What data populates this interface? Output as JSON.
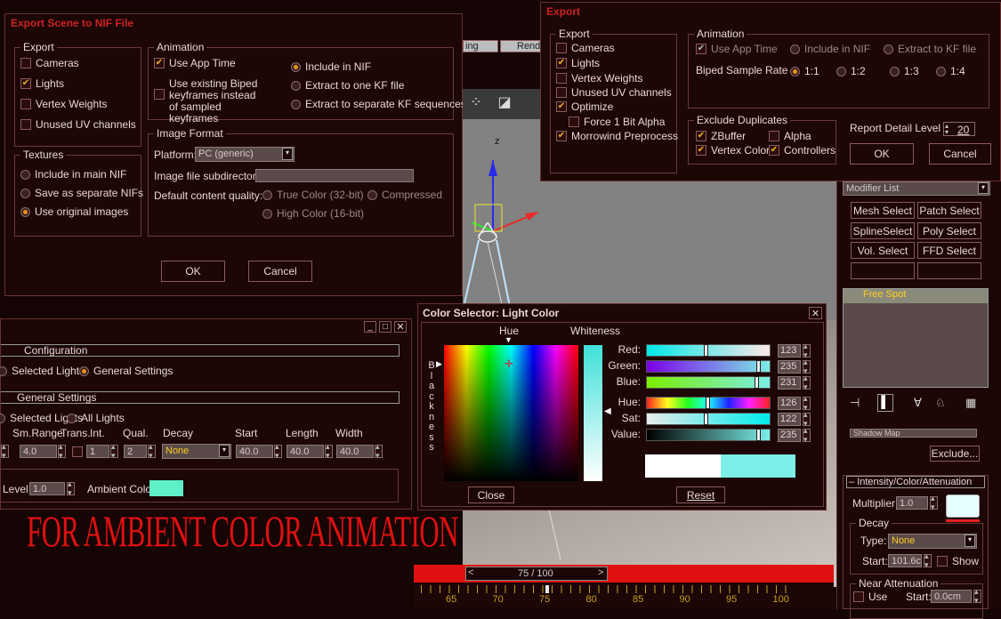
{
  "nif_dialog": {
    "title": "Export Scene to NIF File",
    "export_group": {
      "label": "Export",
      "items": [
        {
          "label": "Cameras",
          "checked": false
        },
        {
          "label": "Lights",
          "checked": true
        },
        {
          "label": "Vertex Weights",
          "checked": false
        },
        {
          "label": "Unused UV channels",
          "checked": false
        }
      ]
    },
    "animation_group": {
      "label": "Animation",
      "use_app_time": "Use App Time",
      "use_existing_biped": "Use existing Biped keyframes instead of sampled keyframes",
      "radios": [
        "Include in NIF",
        "Extract to one KF file",
        "Extract to separate KF sequences"
      ]
    },
    "textures_group": {
      "label": "Textures",
      "radios": [
        "Include in main NIF",
        "Save as separate NIFs",
        "Use original images"
      ]
    },
    "image_format_group": {
      "label": "Image Format",
      "platform_label": "Platform:",
      "platform_value": "PC (generic)",
      "subdir_label": "Image file subdirectory:",
      "quality_label": "Default content quality:",
      "quality_options": [
        "True Color (32-bit)",
        "Compressed",
        "High Color (16-bit)"
      ]
    },
    "ok_label": "OK",
    "cancel_label": "Cancel"
  },
  "tabs_behind": [
    "ing",
    "Rend"
  ],
  "export_dialog": {
    "title": "Export",
    "export_group": {
      "label": "Export",
      "items": [
        {
          "label": "Cameras",
          "checked": false
        },
        {
          "label": "Lights",
          "checked": true
        },
        {
          "label": "Vertex Weights",
          "checked": false
        },
        {
          "label": "Unused UV channels",
          "checked": false
        },
        {
          "label": "Optimize",
          "checked": true
        },
        {
          "label": "Force 1 Bit Alpha",
          "checked": false
        },
        {
          "label": "Morrowind Preprocess",
          "checked": true
        }
      ]
    },
    "animation_group": {
      "label": "Animation",
      "use_app_time": "Use App Time",
      "include_in_nif": "Include in NIF",
      "extract_kf": "Extract to KF file",
      "biped_label": "Biped Sample Rate",
      "rates": [
        "1:1",
        "1:2",
        "1:3",
        "1:4"
      ]
    },
    "exclude_group": {
      "label": "Exclude Duplicates",
      "zbuffer": "ZBuffer",
      "alpha": "Alpha",
      "vertex_colors": "Vertex Colors",
      "controllers": "Controllers"
    },
    "report_label": "Report Detail Level",
    "report_value": "20",
    "ok_label": "OK",
    "cancel_label": "Cancel"
  },
  "command_panel": {
    "modifier_list": "Modifier List",
    "buttons": [
      "Mesh Select",
      "Patch Select",
      "SplineSelect",
      "Poly Select",
      "Vol. Select",
      "FFD Select"
    ],
    "stack_item": "Free Spot",
    "shadow_map": "Shadow Map",
    "exclude_btn": "Exclude...",
    "intensity_header": "Intensity/Color/Attenuation",
    "multiplier_label": "Multiplier:",
    "multiplier_value": "1.0",
    "decay_label": "Decay",
    "type_label": "Type:",
    "type_value": "None",
    "start_label": "Start:",
    "start_value": "101.6c",
    "show_label": "Show",
    "near_label": "Near Attenuation",
    "use_label": "Use",
    "near_start_label": "Start:",
    "near_start_value": "0.0cm"
  },
  "viewport": {
    "axis_z": "z"
  },
  "light_panel": {
    "configuration_header": "Configuration",
    "selected_lights": "Selected Lights",
    "general_settings_radio": "General Settings",
    "general_settings_header": "General Settings",
    "selected_lights2": "Selected Lights",
    "all_lights": "All Lights",
    "col_headers": [
      "Sm.Range",
      "Trans.",
      "Int.",
      "Qual.",
      "Decay",
      "Start",
      "Length",
      "Width"
    ],
    "values": {
      "smrange": "4.0",
      "int": "1",
      "qual": "2",
      "decay": "None",
      "start": "40.0",
      "length": "40.0",
      "width": "40.0"
    },
    "level_label": "Level:",
    "level_value": "1.0",
    "ambient_label": "Ambient Color",
    "ambient_color": "#5ef0c8",
    "banner": "FOR AMBIENT COLOR ANIMATION"
  },
  "color_selector": {
    "title": "Color Selector: Light Color",
    "hue_label": "Hue",
    "whiteness_label": "Whiteness",
    "blackness_letters": [
      "B",
      "l",
      "a",
      "c",
      "k",
      "n",
      "e",
      "s",
      "s"
    ],
    "channels": [
      {
        "label": "Red:",
        "value": "123",
        "fraction": 0.48
      },
      {
        "label": "Green:",
        "value": "235",
        "fraction": 0.92
      },
      {
        "label": "Blue:",
        "value": "231",
        "fraction": 0.9
      }
    ],
    "hsv": [
      {
        "label": "Hue:",
        "value": "126",
        "fraction": 0.49
      },
      {
        "label": "Sat:",
        "value": "122",
        "fraction": 0.48
      },
      {
        "label": "Value:",
        "value": "235",
        "fraction": 0.92
      }
    ],
    "close_label": "Close",
    "reset_label": "Reset",
    "current_color": "#7beee7"
  },
  "timeline": {
    "frame_readout": "75 / 100",
    "ticks": [
      "65",
      "70",
      "75",
      "80",
      "85",
      "90",
      "95",
      "100"
    ]
  }
}
